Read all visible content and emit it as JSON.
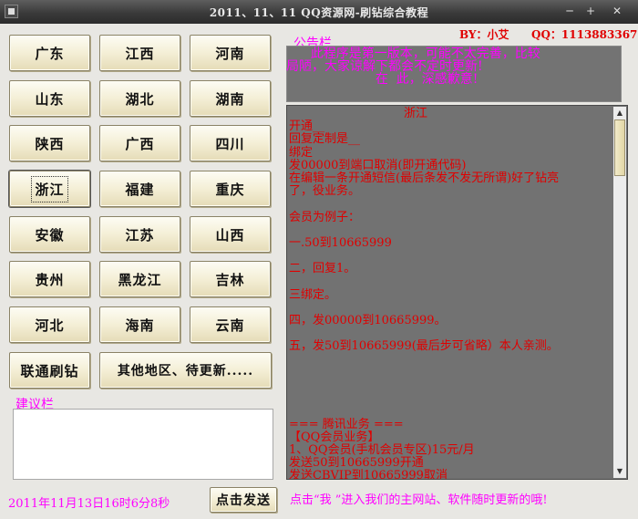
{
  "window": {
    "title": "2011、11、11 QQ资源网-刷钻综合教程",
    "minimize_glyph": "─",
    "maximize_glyph": "+",
    "close_glyph": "✕"
  },
  "regions": {
    "rows": [
      [
        "广东",
        "江西",
        "河南"
      ],
      [
        "山东",
        "湖北",
        "湖南"
      ],
      [
        "陕西",
        "广西",
        "四川"
      ],
      [
        "浙江",
        "福建",
        "重庆"
      ],
      [
        "安徽",
        "江苏",
        "山西"
      ],
      [
        "贵州",
        "黑龙江",
        "吉林"
      ],
      [
        "河北",
        "海南",
        "云南"
      ]
    ],
    "selected": "浙江",
    "unicom": "联通刷钻",
    "other": "其他地区、待更新....."
  },
  "notice": {
    "label": "公告栏",
    "author": "BY：小艾",
    "qq": "QQ：1113883367",
    "lines": [
      "      此程序是第一版本，可能不太完善，比较",
      "局陋，大家谅解下都会不定时更新!",
      "                      在  此，深感歉意!"
    ]
  },
  "content": {
    "title": "浙江",
    "lines": [
      "开通__",
      "回复定制是__",
      "绑定",
      "发00000到端口取消(即开通代码)",
      "在编辑一条开通短信(最后条发不发无所谓)好了钻亮",
      "了，役业务。",
      "",
      "会员为例子：",
      "",
      "一.50到10665999",
      "",
      "二，回复1。",
      "",
      "三绑定。",
      "",
      "四，发00000到10665999。",
      "",
      "五，发50到10665999(最后步可省略）本人亲测。",
      "",
      "",
      "",
      "",
      "",
      "=== 腾讯业务 ===",
      "【QQ会员业务】",
      "1、QQ会员(手机会员专区)15元/月",
      "发送50到10665999开通",
      "发送CBVIP到10665999取消"
    ]
  },
  "suggest": {
    "label": "建议栏",
    "value": ""
  },
  "footer": {
    "datetime": "2011年11月13日16时6分8秒",
    "send": "点击发送",
    "note": "点击“我 ”进入我们的主网站、软件随时更新的哦!"
  },
  "colors": {
    "label": "#ff00ff",
    "content_text": "#e00000",
    "author": "#e00000",
    "panel_bg": "#727272",
    "window_bg": "#e8e7e3"
  }
}
